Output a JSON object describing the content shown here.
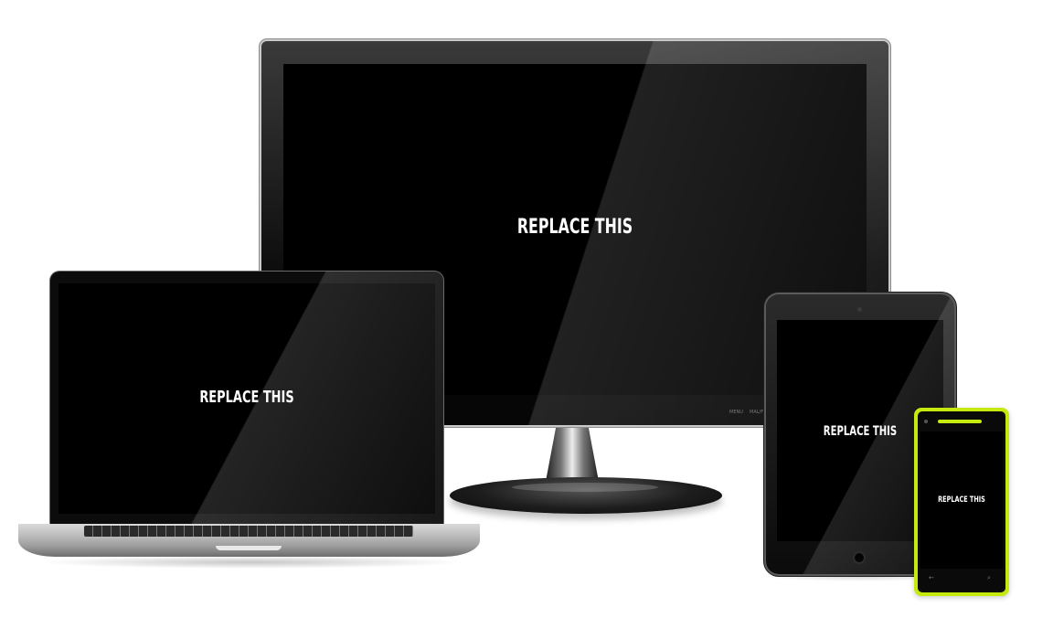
{
  "devices": {
    "monitor": {
      "screen_label": "REPLACE THIS",
      "buttons": [
        "MENU",
        "MAL/F"
      ]
    },
    "laptop": {
      "screen_label": "REPLACE THIS"
    },
    "tablet": {
      "screen_label": "REPLACE THIS"
    },
    "phone": {
      "screen_label": "REPLACE THIS",
      "back_key": "←",
      "search_key": "⌕",
      "accent_color": "#c4ea0f"
    }
  }
}
